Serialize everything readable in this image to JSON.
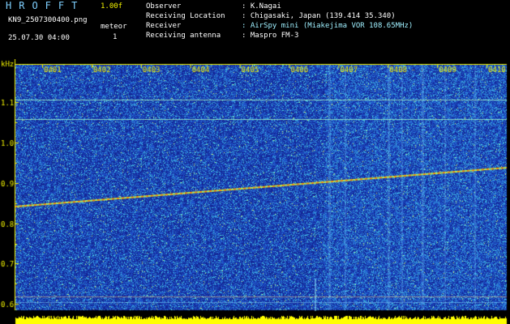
{
  "header": {
    "app_title": "HROFFT",
    "version": "1.00f",
    "filename": "KN9_2507300400.png",
    "datetime": "25.07.30 04:00",
    "meteor_label": "meteor",
    "meteor_count": "1",
    "info": [
      {
        "label": "Observer",
        "value": ": K.Nagai"
      },
      {
        "label": "Receiving Location",
        "value": ": Chigasaki, Japan (139.414 35.340)"
      },
      {
        "label": "Receiver",
        "value": ": AirSpy mini (Miakejima VOR 108.65MHz)"
      },
      {
        "label": "Receiving antenna",
        "value": ": Maspro FM-3"
      }
    ]
  },
  "spectrogram": {
    "unit_label": "kHz",
    "time_ticks": [
      "0401",
      "0402",
      "0403",
      "0404",
      "0405",
      "0406",
      "0407",
      "0408",
      "0409",
      "0410"
    ],
    "freq_ticks": [
      "1.1",
      "1.0",
      "0.9",
      "0.8",
      "0.7",
      "0.6"
    ]
  },
  "colors": {
    "background": "#000000",
    "noise_dark": "#1a3fb5",
    "noise_light": "#2f6bd8",
    "signal": "#ff9a00",
    "label": "#f2f200",
    "amplitude_bar": "#ffff00"
  }
}
